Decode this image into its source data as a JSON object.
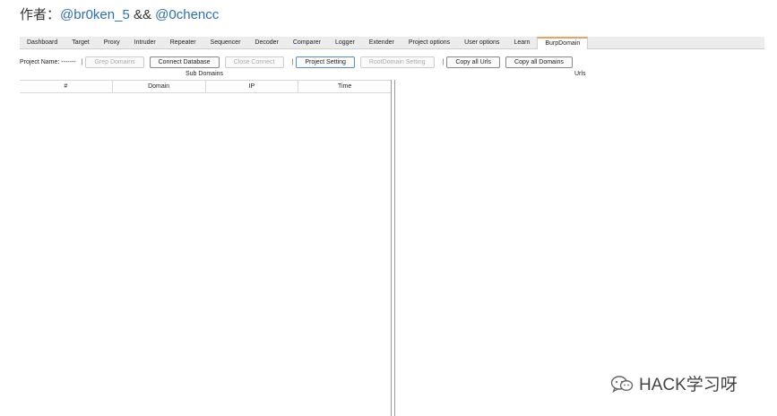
{
  "header": {
    "prefix": "作者：",
    "author1": "@br0ken_5",
    "joiner": "&&",
    "author2": "@0chencc"
  },
  "tabs": [
    {
      "label": "Dashboard"
    },
    {
      "label": "Target"
    },
    {
      "label": "Proxy"
    },
    {
      "label": "Intruder"
    },
    {
      "label": "Repeater"
    },
    {
      "label": "Sequencer"
    },
    {
      "label": "Decoder"
    },
    {
      "label": "Comparer"
    },
    {
      "label": "Logger"
    },
    {
      "label": "Extender"
    },
    {
      "label": "Project options"
    },
    {
      "label": "User options"
    },
    {
      "label": "Learn"
    },
    {
      "label": "BurpDomain"
    }
  ],
  "toolbar": {
    "project_name_label": "Project Name: -------",
    "sep": "|",
    "grep_domains": "Grep Domains",
    "connect_database": "Connect Database",
    "close_connect": "Close Connect",
    "project_setting": "Project Setting",
    "rootdomain_setting": "RootDomain Setting",
    "copy_all_urls": "Copy all Urls",
    "copy_all_domains": "Copy all Domains"
  },
  "subdomains": {
    "title": "Sub Domains",
    "columns": [
      "#",
      "Domain",
      "IP",
      "Time"
    ]
  },
  "urls": {
    "title": "Urls"
  },
  "watermark": {
    "text": "HACK学习呀"
  }
}
